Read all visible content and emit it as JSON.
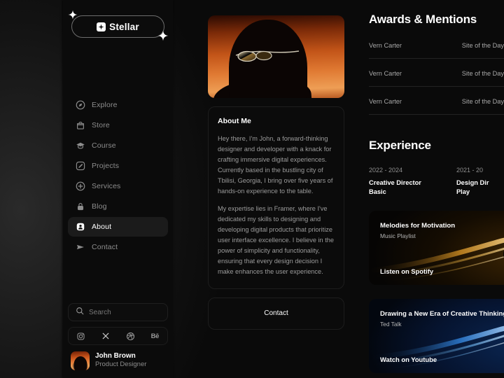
{
  "brand": {
    "name": "Stellar",
    "logo_icon": "sparkle-badge-icon"
  },
  "sidebar": {
    "nav": [
      {
        "label": "Explore",
        "icon": "compass-icon"
      },
      {
        "label": "Store",
        "icon": "shopping-bag-icon"
      },
      {
        "label": "Course",
        "icon": "graduation-cap-icon"
      },
      {
        "label": "Projects",
        "icon": "pencil-icon"
      },
      {
        "label": "Services",
        "icon": "plus-circle-icon"
      },
      {
        "label": "Blog",
        "icon": "lock-icon"
      },
      {
        "label": "About",
        "icon": "user-badge-icon",
        "active": true
      },
      {
        "label": "Contact",
        "icon": "paper-plane-icon"
      }
    ],
    "search": {
      "placeholder": "Search",
      "icon": "search-icon"
    },
    "socials": [
      {
        "name": "instagram-icon",
        "label": ""
      },
      {
        "name": "x-icon",
        "label": ""
      },
      {
        "name": "dribbble-icon",
        "label": ""
      },
      {
        "name": "behance-icon",
        "label": "Bē"
      }
    ],
    "profile": {
      "name": "John Brown",
      "role": "Product Designer",
      "avatar": "portrait-avatar"
    }
  },
  "main": {
    "hero_image_alt": "portrait-sunglasses-orange",
    "about": {
      "title": "About Me",
      "paragraph1": "Hey there, I'm John, a forward-thinking designer and developer with a knack for crafting immersive digital experiences. Currently based in the bustling city of Tbilisi, Georgia, I bring over five years of hands-on experience to the table.",
      "paragraph2": "My expertise lies in Framer, where I've dedicated my skills to designing and developing digital products that prioritize user interface excellence. I believe in the power of simplicity and functionality, ensuring that every design decision I make enhances the user experience."
    },
    "contact_button": "Contact"
  },
  "right": {
    "awards": {
      "title": "Awards & Mentions",
      "rows": [
        {
          "name": "Vern Carter",
          "tag": "Site of the Day"
        },
        {
          "name": "Vern Carter",
          "tag": "Site of the Day"
        },
        {
          "name": "Vern Carter",
          "tag": "Site of the Day"
        }
      ]
    },
    "experience": {
      "title": "Experience",
      "items": [
        {
          "years": "2022 - 2024",
          "role": "Creative Director",
          "company": "Basic"
        },
        {
          "years": "2021 - 20",
          "role": "Design Dir",
          "company": "Play"
        }
      ]
    },
    "media": [
      {
        "title": "Melodies for Motivation",
        "subtitle": "Music Playlist",
        "cta": "Listen  on Spotify",
        "theme": "warm"
      },
      {
        "title": "Drawing a New Era of Creative Thinking\"",
        "subtitle": "Ted Talk",
        "cta": "Watch on Youtube",
        "theme": "cool"
      }
    ]
  },
  "colors": {
    "page_bg": "#070707",
    "panel_bg": "#0b0b0b",
    "accent_warm": "#e8823c",
    "accent_cool": "#3d8fe0",
    "text_primary": "#ffffff",
    "text_muted": "#8d8d8d"
  }
}
